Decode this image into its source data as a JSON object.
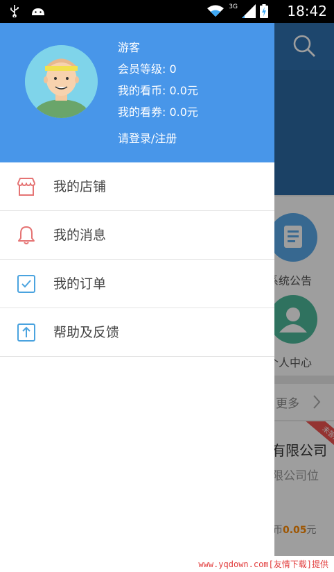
{
  "status_bar": {
    "time": "18:42",
    "network": "3G",
    "icons": [
      "usb-icon",
      "android-icon",
      "wifi-icon",
      "signal-icon",
      "battery-icon"
    ]
  },
  "drawer": {
    "user": {
      "name": "游客",
      "member_level": "会员等级: 0",
      "coins": "我的看币: 0.0元",
      "coupons": "我的看券: 0.0元",
      "login_link": "请登录/注册"
    },
    "menu": [
      {
        "label": "我的店铺",
        "icon": "store-icon"
      },
      {
        "label": "我的消息",
        "icon": "bell-icon"
      },
      {
        "label": "我的订单",
        "icon": "checkbox-icon"
      },
      {
        "label": "帮助及反馈",
        "icon": "upload-icon"
      }
    ]
  },
  "background": {
    "grid_labels": [
      "系统公告",
      "个人中心"
    ],
    "more_label": "更多",
    "card_title": "有限公司",
    "card_subtitle": "限公司位",
    "card_price_prefix": "币",
    "card_price_value": "0.05",
    "card_price_suffix": "元",
    "ribbon": "未答题"
  },
  "footer": {
    "watermark": "www.yqdown.com[友情下载]提供"
  },
  "colors": {
    "drawer_header": "#4896e9",
    "icon_red": "#e57373",
    "icon_blue": "#4aa3df",
    "bg_header": "#2f72b0",
    "price": "#ff8a00"
  }
}
